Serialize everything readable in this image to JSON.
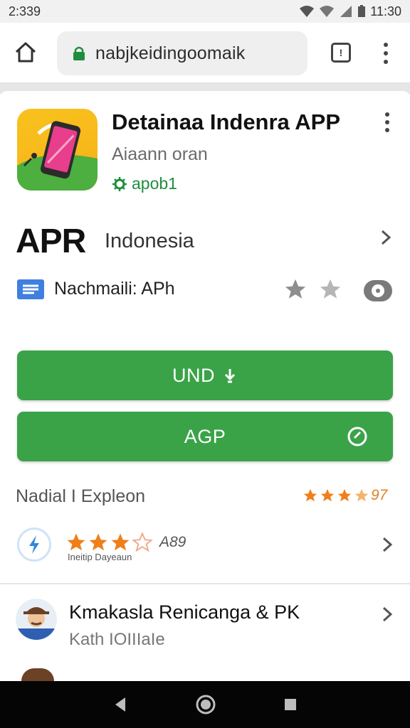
{
  "status_bar": {
    "time_left": "2:339",
    "time_right": "11:30"
  },
  "browser": {
    "url": "nabjkeidingoomaik",
    "tab_count": "!"
  },
  "app": {
    "title": "Detainaa Indenra APP",
    "developer": "Aiaann oran",
    "badge": "apob1",
    "rating_label": "APR",
    "region": "Indonesia",
    "info_text": "Nachmaili: APh"
  },
  "buttons": {
    "install_label": "UND",
    "open_label": "AGP"
  },
  "reviews_section": {
    "title": "Nadial I Expleon",
    "rating_text": "97",
    "items": [
      {
        "score": "A89",
        "subtitle": "Ineitip Dayeaun"
      },
      {
        "title": "Kmakasla Renicanga & PK",
        "subtitle": "Kath IOIIIaIe"
      }
    ]
  },
  "colors": {
    "accent_green": "#3aa348",
    "star_orange": "#ef7f1a",
    "star_gray": "#8e8e8e"
  },
  "icons": [
    "home-icon",
    "lock-icon",
    "tabs-icon",
    "menu-icon",
    "kebab-icon",
    "chevron-right-icon",
    "document-icon",
    "star-icon",
    "eye-icon",
    "download-icon",
    "refresh-icon",
    "flash-icon",
    "back-icon",
    "home-circle-icon",
    "recents-icon"
  ]
}
